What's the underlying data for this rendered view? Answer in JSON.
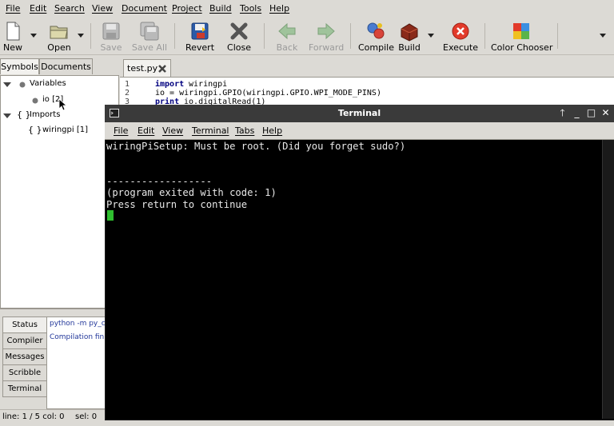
{
  "menubar": {
    "items": [
      "File",
      "Edit",
      "Search",
      "View",
      "Document",
      "Project",
      "Build",
      "Tools",
      "Help"
    ]
  },
  "toolbar": {
    "new": "New",
    "open": "Open",
    "save": "Save",
    "save_all": "Save All",
    "revert": "Revert",
    "close": "Close",
    "back": "Back",
    "forward": "Forward",
    "compile": "Compile",
    "build": "Build",
    "execute": "Execute",
    "color_chooser": "Color Chooser"
  },
  "sidebar": {
    "tabs": [
      "Symbols",
      "Documents"
    ],
    "tree": {
      "variables": "Variables",
      "io": "io [2]",
      "imports": "Imports",
      "wiringpi": "wiringpi [1]"
    }
  },
  "editor": {
    "tab_label": "test.py",
    "line_numbers": [
      "1",
      "2",
      "3"
    ],
    "lines": [
      {
        "kw": "import",
        "rest": " wiringpi"
      },
      {
        "kw": "",
        "rest": "io = wiringpi.GPIO(wiringpi.GPIO.WPI_MODE_PINS)"
      },
      {
        "kw": "print",
        "rest": " io.digitalRead(1)"
      }
    ]
  },
  "messages": {
    "tabs": [
      "Status",
      "Compiler",
      "Messages",
      "Scribble",
      "Terminal"
    ],
    "lines": [
      "python -m py_c",
      "Compilation fin"
    ]
  },
  "statusbar": {
    "line_col": "line: 1 / 5  col: 0",
    "sel": "sel: 0"
  },
  "terminal": {
    "title": "Terminal",
    "menu": [
      "File",
      "Edit",
      "View",
      "Terminal",
      "Tabs",
      "Help"
    ],
    "output": "wiringPiSetup: Must be root. (Did you forget sudo?)\n\n\n------------------\n(program exited with code: 1)\nPress return to continue",
    "colors": {
      "background": "#000000",
      "text": "#e8e8e8",
      "cursor": "#2fbf2f"
    }
  },
  "colors": {
    "keyword": "#00007f",
    "window_bg": "#dcdad5"
  }
}
